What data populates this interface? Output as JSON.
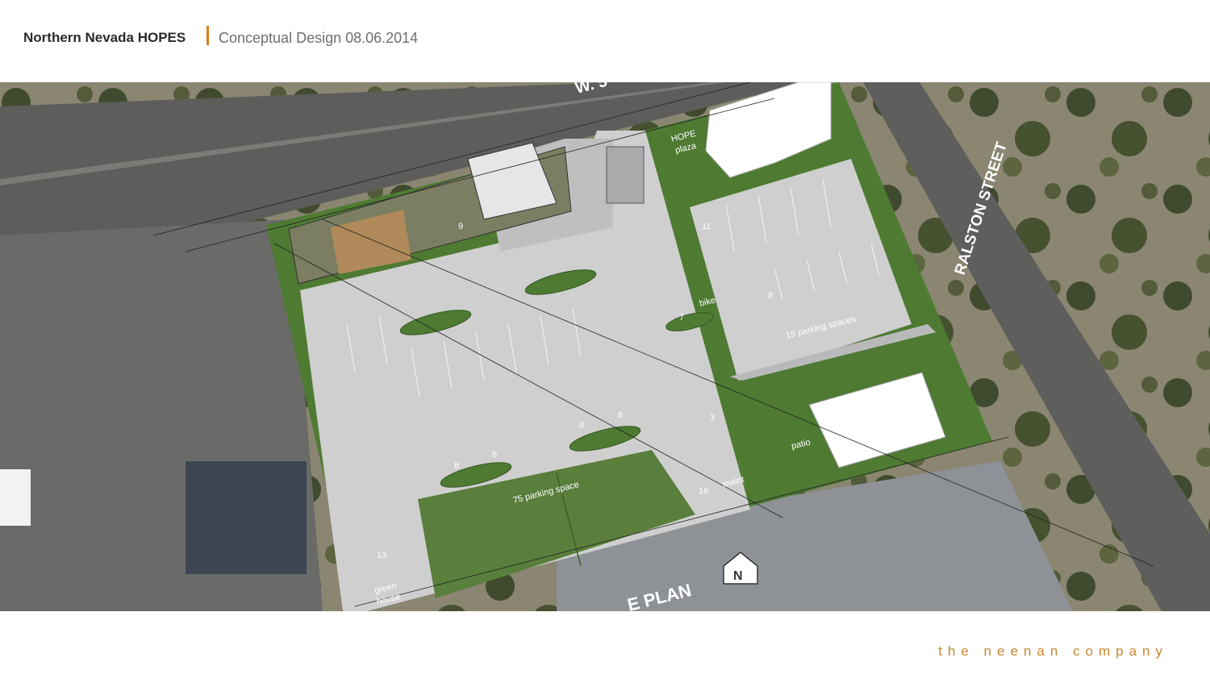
{
  "header": {
    "project_title": "Northern Nevada HOPES",
    "subtitle": "Conceptual Design 08.06.2014"
  },
  "plan": {
    "street_north": "W. 5",
    "street_east": "RALSTON STREET",
    "plan_label": "E PLAN",
    "areas": {
      "hope_plaza": "HOPE\nplaza",
      "hope_plaza_1": "HOPE",
      "hope_plaza_2": "plaza",
      "bike": "bike",
      "maint": "maint",
      "patio": "patio",
      "greenhouse_1": "green",
      "greenhouse_2": "house",
      "parking_75": "75 parking space",
      "parking_19": "19 parking spaces"
    },
    "space_counts": [
      "11",
      "8",
      "7",
      "9",
      "8",
      "8",
      "8",
      "8",
      "3",
      "16",
      "13"
    ],
    "north_arrow": "N"
  },
  "footer": {
    "brand": "the neenan company"
  },
  "colors": {
    "accent": "#e07b1a",
    "brand": "#c8872e",
    "green": "#4e7a32",
    "paving": "#cfcfcf"
  }
}
